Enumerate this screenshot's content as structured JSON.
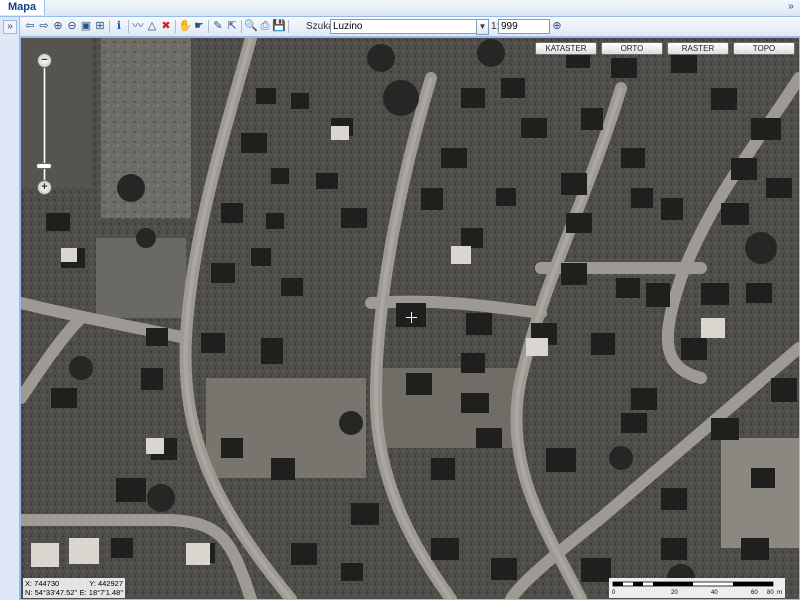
{
  "tabs": [
    {
      "label": "Mapa"
    }
  ],
  "panel": {
    "collapse_icon": "double-chevron-down-icon",
    "expand_icon": "double-chevron-right-icon"
  },
  "toolbar": {
    "search_label": "Szukaj:",
    "search_value": "Luzino",
    "scale_label": "1:",
    "scale_value": "999"
  },
  "layers": [
    {
      "label": "KATASTER"
    },
    {
      "label": "ORTO"
    },
    {
      "label": "RASTER"
    },
    {
      "label": "TOPO"
    }
  ],
  "coords": {
    "x": "X: 744730",
    "y": "Y: 442927",
    "n": "N: 54°33'47.52\"",
    "e": "E: 18°7'1.48\""
  },
  "scale_bar": {
    "ticks": [
      "0",
      "20",
      "40",
      "60",
      "80"
    ],
    "unit": "m"
  }
}
